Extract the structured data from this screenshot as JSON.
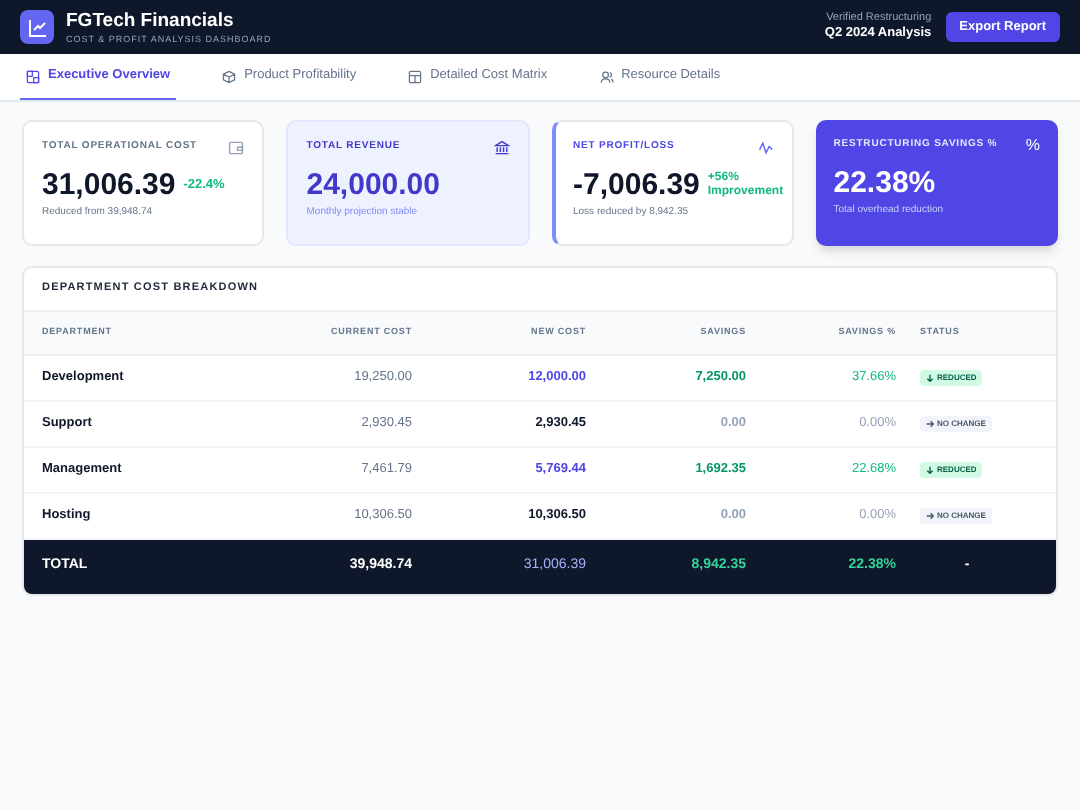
{
  "header": {
    "title": "FGTech Financials",
    "subtitle": "COST & PROFIT ANALYSIS DASHBOARD",
    "note": "Verified Restructuring",
    "period": "Q2 2024 Analysis",
    "button": "Export Report"
  },
  "tabs": [
    {
      "label": "Executive Overview",
      "selected": true
    },
    {
      "label": "Product Profitability",
      "selected": false
    },
    {
      "label": "Detailed Cost Matrix",
      "selected": false
    },
    {
      "label": "Resource Details",
      "selected": false
    }
  ],
  "cards": [
    {
      "kind": "cost",
      "label": "TOTAL OPERATIONAL COST",
      "value": "31,006.39",
      "change": "-22.4%",
      "note": "Reduced from 39,948.74"
    },
    {
      "kind": "revenue",
      "label": "TOTAL REVENUE",
      "value": "24,000.00",
      "note": "Monthly projection stable"
    },
    {
      "kind": "profit",
      "label": "NET PROFIT/LOSS",
      "value": "-7,006.39",
      "change": "+56% Improvement",
      "note": "Loss reduced by 8,942.35"
    },
    {
      "kind": "savings",
      "label": "RESTRUCTURING SAVINGS %",
      "icon_text": "%",
      "value": "22.38%",
      "note": "Total overhead reduction"
    }
  ],
  "table": {
    "title": "DEPARTMENT COST BREAKDOWN",
    "columns": [
      "DEPARTMENT",
      "CURRENT COST",
      "NEW COST",
      "SAVINGS",
      "SAVINGS %",
      "STATUS"
    ],
    "rows": [
      {
        "department": "Development",
        "current": "19,250.00",
        "new": "12,000.00",
        "savings": "7,250.00",
        "pct": "37.66%",
        "status": "REDUCED",
        "kind": "reduced"
      },
      {
        "department": "Support",
        "current": "2,930.45",
        "new": "2,930.45",
        "savings": "0.00",
        "pct": "0.00%",
        "status": "NO CHANGE",
        "kind": "same"
      },
      {
        "department": "Management",
        "current": "7,461.79",
        "new": "5,769.44",
        "savings": "1,692.35",
        "pct": "22.68%",
        "status": "REDUCED",
        "kind": "reduced"
      },
      {
        "department": "Hosting",
        "current": "10,306.50",
        "new": "10,306.50",
        "savings": "0.00",
        "pct": "0.00%",
        "status": "NO CHANGE",
        "kind": "same"
      }
    ],
    "total": {
      "label": "TOTAL",
      "current": "39,948.74",
      "new": "31,006.39",
      "savings": "8,942.35",
      "pct": "22.38%",
      "status": "-"
    }
  }
}
